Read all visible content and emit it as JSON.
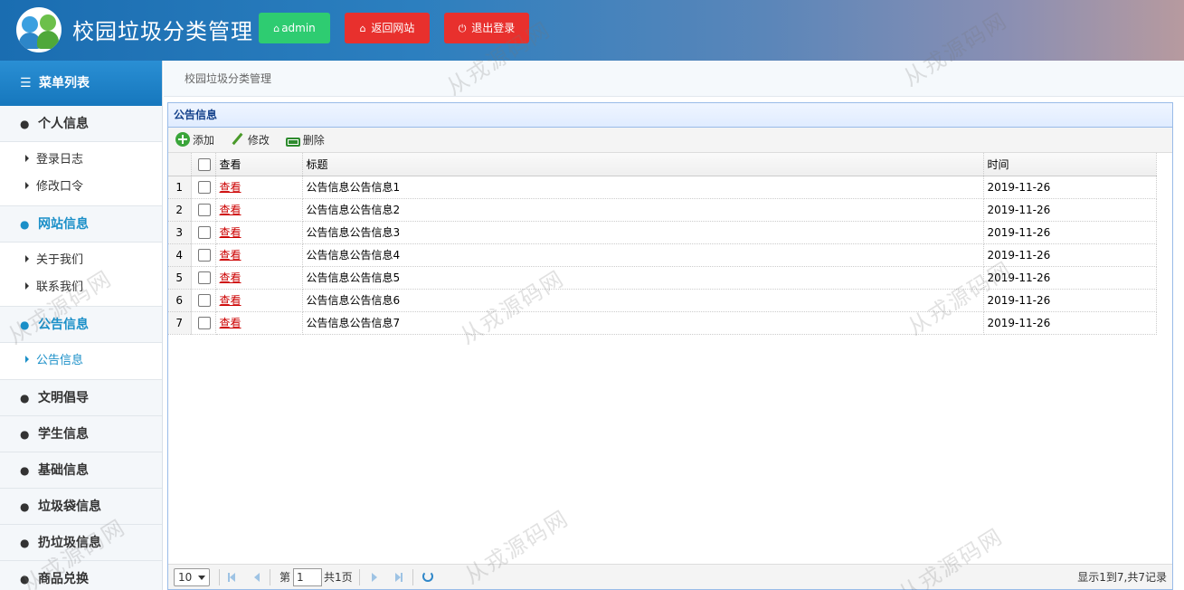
{
  "header": {
    "title": "校园垃圾分类管理",
    "admin_label": "admin",
    "back_label": "返回网站",
    "logout_label": "退出登录"
  },
  "sidebar": {
    "heading": "菜单列表",
    "groups": [
      {
        "label": "个人信息",
        "items": [
          "登录日志",
          "修改口令"
        ]
      },
      {
        "label": "网站信息",
        "items": [
          "关于我们",
          "联系我们"
        ]
      },
      {
        "label": "公告信息",
        "items": [
          "公告信息"
        ]
      },
      {
        "label": "文明倡导"
      },
      {
        "label": "学生信息"
      },
      {
        "label": "基础信息"
      },
      {
        "label": "垃圾袋信息"
      },
      {
        "label": "扔垃圾信息"
      },
      {
        "label": "商品兑换"
      }
    ]
  },
  "breadcrumb": "校园垃圾分类管理",
  "panel": {
    "title": "公告信息",
    "toolbar": {
      "add": "添加",
      "edit": "修改",
      "delete": "删除"
    },
    "columns": {
      "view": "查看",
      "title": "标题",
      "time": "时间"
    },
    "rows": [
      {
        "n": "1",
        "view": "查看",
        "title": "公告信息公告信息1",
        "time": "2019-11-26"
      },
      {
        "n": "2",
        "view": "查看",
        "title": "公告信息公告信息2",
        "time": "2019-11-26"
      },
      {
        "n": "3",
        "view": "查看",
        "title": "公告信息公告信息3",
        "time": "2019-11-26"
      },
      {
        "n": "4",
        "view": "查看",
        "title": "公告信息公告信息4",
        "time": "2019-11-26"
      },
      {
        "n": "5",
        "view": "查看",
        "title": "公告信息公告信息5",
        "time": "2019-11-26"
      },
      {
        "n": "6",
        "view": "查看",
        "title": "公告信息公告信息6",
        "time": "2019-11-26"
      },
      {
        "n": "7",
        "view": "查看",
        "title": "公告信息公告信息7",
        "time": "2019-11-26"
      }
    ]
  },
  "pager": {
    "page_size": "10",
    "page_prefix": "第",
    "page_value": "1",
    "page_total": "共1页",
    "info": "显示1到7,共7记录"
  },
  "watermark": "从戎源码网"
}
